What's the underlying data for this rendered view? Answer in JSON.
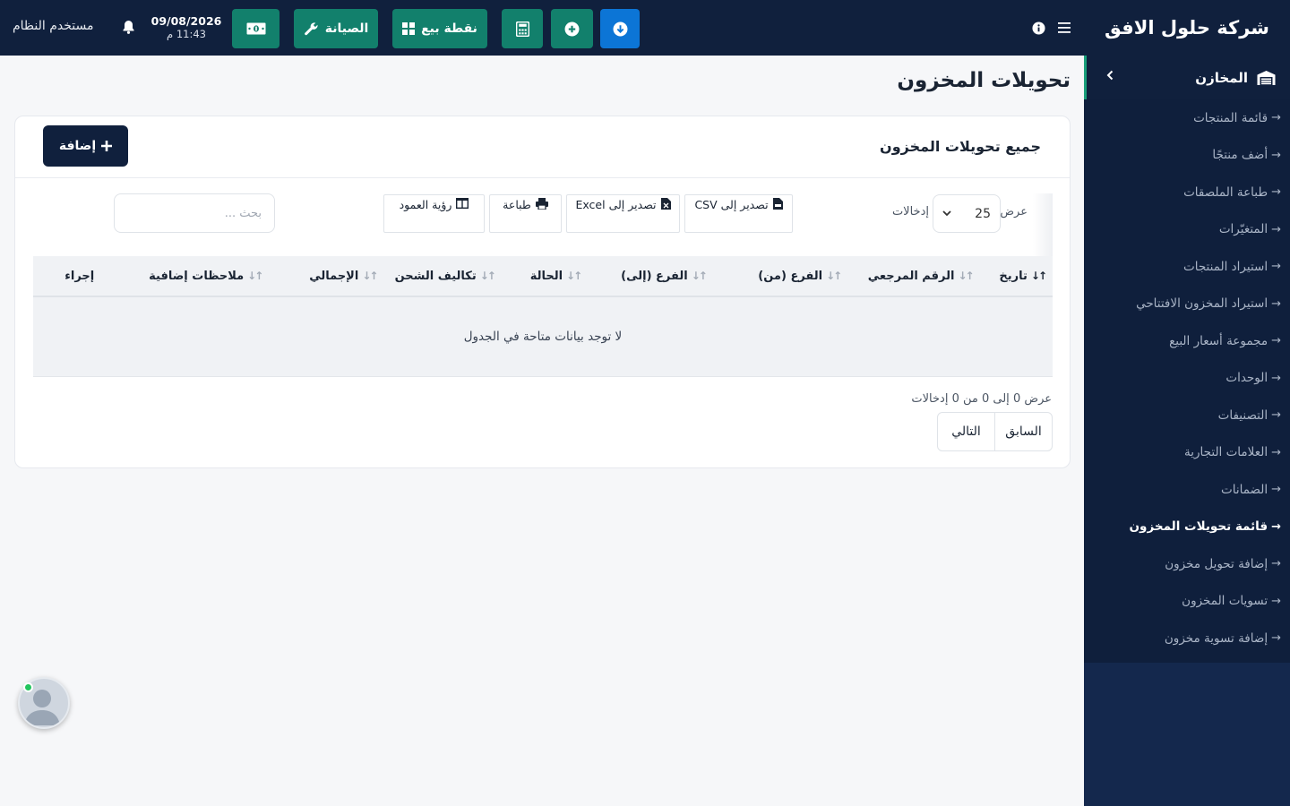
{
  "brand": "شركة حلول الافق",
  "topbar": {
    "pos_label": "نقطة بيع",
    "maintenance_label": "الصيانة",
    "date": "09/08/2026",
    "time": "11:43 م",
    "user": "مستخدم النظام"
  },
  "sidebar": {
    "section": "المخازن",
    "items": [
      {
        "label": "قائمة المنتجات"
      },
      {
        "label": "أضف منتجًا"
      },
      {
        "label": "طباعة الملصقات"
      },
      {
        "label": "المتغيّرات"
      },
      {
        "label": "استيراد المنتجات"
      },
      {
        "label": "استيراد المخزون الافتتاحي"
      },
      {
        "label": "مجموعة أسعار البيع"
      },
      {
        "label": "الوحدات"
      },
      {
        "label": "التصنيفات"
      },
      {
        "label": "العلامات التجارية"
      },
      {
        "label": "الضمانات"
      },
      {
        "label": "قائمة تحويلات المخزون"
      },
      {
        "label": "إضافة تحويل مخزون"
      },
      {
        "label": "تسويات المخزون"
      },
      {
        "label": "إضافة تسوية مخزون"
      }
    ],
    "active_index": 11
  },
  "page": {
    "title": "تحويلات المخزون"
  },
  "card": {
    "title": "جميع تحويلات المخزون",
    "add_label": "إضافة"
  },
  "controls": {
    "show_label": "عرض",
    "page_length": "25",
    "entries_label": "إدخالات",
    "csv_label": "تصدير إلى CSV",
    "excel_label": "تصدير إلى Excel",
    "print_label": "طباعة",
    "colvis_label": "رؤية العمود",
    "search_placeholder": "بحث ..."
  },
  "table": {
    "columns": [
      "تاريخ",
      "الرقم المرجعي",
      "الفرع (من)",
      "الفرع (إلى)",
      "الحالة",
      "تكاليف الشحن",
      "الإجمالي",
      "ملاحظات إضافية",
      "إجراء"
    ],
    "empty_message": "لا توجد بيانات متاحة في الجدول"
  },
  "footer": {
    "info": "عرض 0 إلى 0 من 0 إدخالات",
    "prev_label": "السابق",
    "next_label": "التالي"
  }
}
